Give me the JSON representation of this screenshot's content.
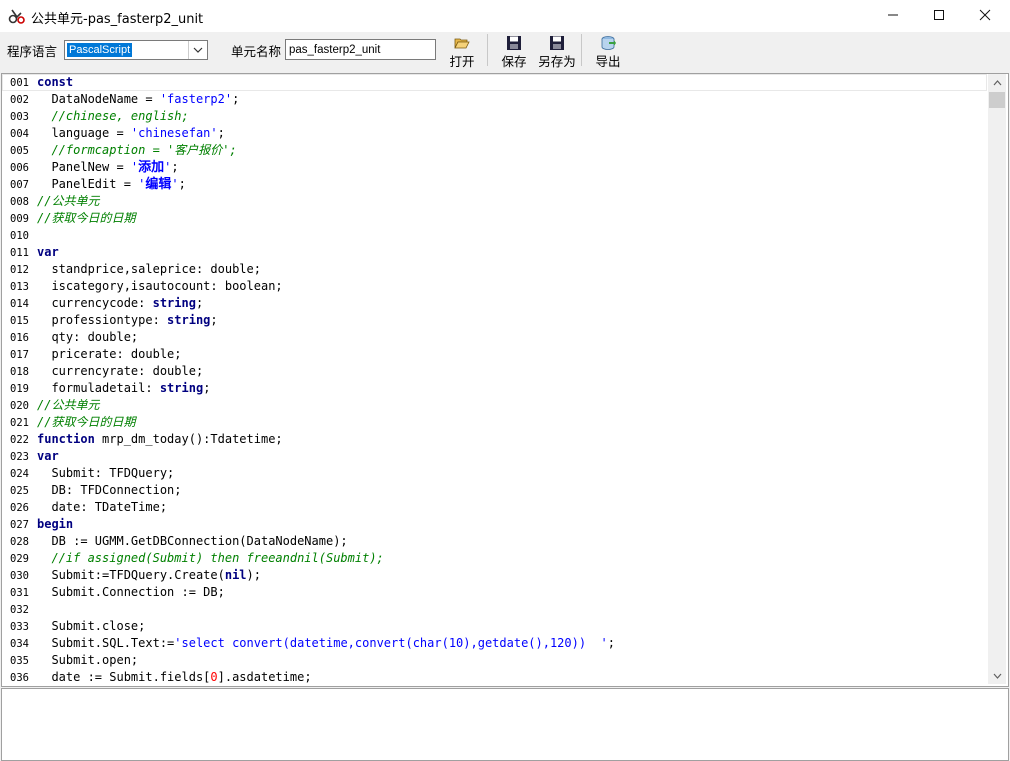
{
  "window": {
    "title": "公共单元-pas_fasterp2_unit",
    "minimize_glyph": "—",
    "maximize_glyph": "☐",
    "close_glyph": "✕"
  },
  "toolbar": {
    "language_label": "程序语言",
    "language_value": "PascalScript",
    "unit_label": "单元名称",
    "unit_value": "pas_fasterp2_unit",
    "open_label": "打开",
    "save_label": "保存",
    "saveas_label": "另存为",
    "export_label": "导出"
  },
  "colors": {
    "keyword": "#000080",
    "comment": "#008000",
    "string": "#0000ff",
    "number": "#ff0000",
    "selection": "#0078d7"
  },
  "icons": [
    "app-icon",
    "chevron-down-icon",
    "folder-open-icon",
    "floppy-save-icon",
    "floppy-saveas-icon",
    "database-export-icon",
    "scroll-up-icon",
    "scroll-down-icon"
  ],
  "editor": {
    "lines": [
      {
        "n": "001",
        "t": [
          {
            "k": "kw",
            "v": "const"
          }
        ]
      },
      {
        "n": "002",
        "t": [
          {
            "k": "p",
            "v": "  DataNodeName = "
          },
          {
            "k": "st",
            "v": "'fasterp2'"
          },
          {
            "k": "p",
            "v": ";"
          }
        ]
      },
      {
        "n": "003",
        "t": [
          {
            "k": "cm",
            "v": "  //chinese, english;"
          }
        ]
      },
      {
        "n": "004",
        "t": [
          {
            "k": "p",
            "v": "  language = "
          },
          {
            "k": "st",
            "v": "'chinesefan'"
          },
          {
            "k": "p",
            "v": ";"
          }
        ]
      },
      {
        "n": "005",
        "t": [
          {
            "k": "cm",
            "v": "  //formcaption = '客户报价';"
          }
        ]
      },
      {
        "n": "006",
        "t": [
          {
            "k": "p",
            "v": "  PanelNew = "
          },
          {
            "k": "st",
            "v": "'"
          },
          {
            "k": "stb",
            "v": "添加"
          },
          {
            "k": "st",
            "v": "'"
          },
          {
            "k": "p",
            "v": ";"
          }
        ]
      },
      {
        "n": "007",
        "t": [
          {
            "k": "p",
            "v": "  PanelEdit = "
          },
          {
            "k": "st",
            "v": "'"
          },
          {
            "k": "stb",
            "v": "编辑"
          },
          {
            "k": "st",
            "v": "'"
          },
          {
            "k": "p",
            "v": ";"
          }
        ]
      },
      {
        "n": "008",
        "t": [
          {
            "k": "cm",
            "v": "//公共单元"
          }
        ]
      },
      {
        "n": "009",
        "t": [
          {
            "k": "cm",
            "v": "//获取今日的日期"
          }
        ]
      },
      {
        "n": "010",
        "t": []
      },
      {
        "n": "011",
        "t": [
          {
            "k": "kw",
            "v": "var"
          }
        ]
      },
      {
        "n": "012",
        "t": [
          {
            "k": "p",
            "v": "  standprice,saleprice: double;"
          }
        ]
      },
      {
        "n": "013",
        "t": [
          {
            "k": "p",
            "v": "  iscategory,isautocount: boolean;"
          }
        ]
      },
      {
        "n": "014",
        "t": [
          {
            "k": "p",
            "v": "  currencycode: "
          },
          {
            "k": "kw",
            "v": "string"
          },
          {
            "k": "p",
            "v": ";"
          }
        ]
      },
      {
        "n": "015",
        "t": [
          {
            "k": "p",
            "v": "  professiontype: "
          },
          {
            "k": "kw",
            "v": "string"
          },
          {
            "k": "p",
            "v": ";"
          }
        ]
      },
      {
        "n": "016",
        "t": [
          {
            "k": "p",
            "v": "  qty: double;"
          }
        ]
      },
      {
        "n": "017",
        "t": [
          {
            "k": "p",
            "v": "  pricerate: double;"
          }
        ]
      },
      {
        "n": "018",
        "t": [
          {
            "k": "p",
            "v": "  currencyrate: double;"
          }
        ]
      },
      {
        "n": "019",
        "t": [
          {
            "k": "p",
            "v": "  formuladetail: "
          },
          {
            "k": "kw",
            "v": "string"
          },
          {
            "k": "p",
            "v": ";"
          }
        ]
      },
      {
        "n": "020",
        "t": [
          {
            "k": "cm",
            "v": "//公共单元"
          }
        ]
      },
      {
        "n": "021",
        "t": [
          {
            "k": "cm",
            "v": "//获取今日的日期"
          }
        ]
      },
      {
        "n": "022",
        "t": [
          {
            "k": "kw",
            "v": "function"
          },
          {
            "k": "p",
            "v": " mrp_dm_today():Tdatetime;"
          }
        ]
      },
      {
        "n": "023",
        "t": [
          {
            "k": "kw",
            "v": "var"
          }
        ]
      },
      {
        "n": "024",
        "t": [
          {
            "k": "p",
            "v": "  Submit: TFDQuery;"
          }
        ]
      },
      {
        "n": "025",
        "t": [
          {
            "k": "p",
            "v": "  DB: TFDConnection;"
          }
        ]
      },
      {
        "n": "026",
        "t": [
          {
            "k": "p",
            "v": "  date: TDateTime;"
          }
        ]
      },
      {
        "n": "027",
        "t": [
          {
            "k": "kw",
            "v": "begin"
          }
        ]
      },
      {
        "n": "028",
        "t": [
          {
            "k": "p",
            "v": "  DB := UGMM.GetDBConnection(DataNodeName);"
          }
        ]
      },
      {
        "n": "029",
        "t": [
          {
            "k": "cm",
            "v": "  //if assigned(Submit) then freeandnil(Submit);"
          }
        ]
      },
      {
        "n": "030",
        "t": [
          {
            "k": "p",
            "v": "  Submit:=TFDQuery.Create("
          },
          {
            "k": "kw",
            "v": "nil"
          },
          {
            "k": "p",
            "v": ");"
          }
        ]
      },
      {
        "n": "031",
        "t": [
          {
            "k": "p",
            "v": "  Submit.Connection := DB;"
          }
        ]
      },
      {
        "n": "032",
        "t": []
      },
      {
        "n": "033",
        "t": [
          {
            "k": "p",
            "v": "  Submit.close;"
          }
        ]
      },
      {
        "n": "034",
        "t": [
          {
            "k": "p",
            "v": "  Submit.SQL.Text:="
          },
          {
            "k": "st",
            "v": "'select convert(datetime,convert(char(10),getdate(),120))  '"
          },
          {
            "k": "p",
            "v": ";"
          }
        ]
      },
      {
        "n": "035",
        "t": [
          {
            "k": "p",
            "v": "  Submit.open;"
          }
        ]
      },
      {
        "n": "036",
        "t": [
          {
            "k": "p",
            "v": "  date := Submit.fields["
          },
          {
            "k": "num",
            "v": "0"
          },
          {
            "k": "p",
            "v": "].asdatetime;"
          }
        ]
      }
    ]
  }
}
